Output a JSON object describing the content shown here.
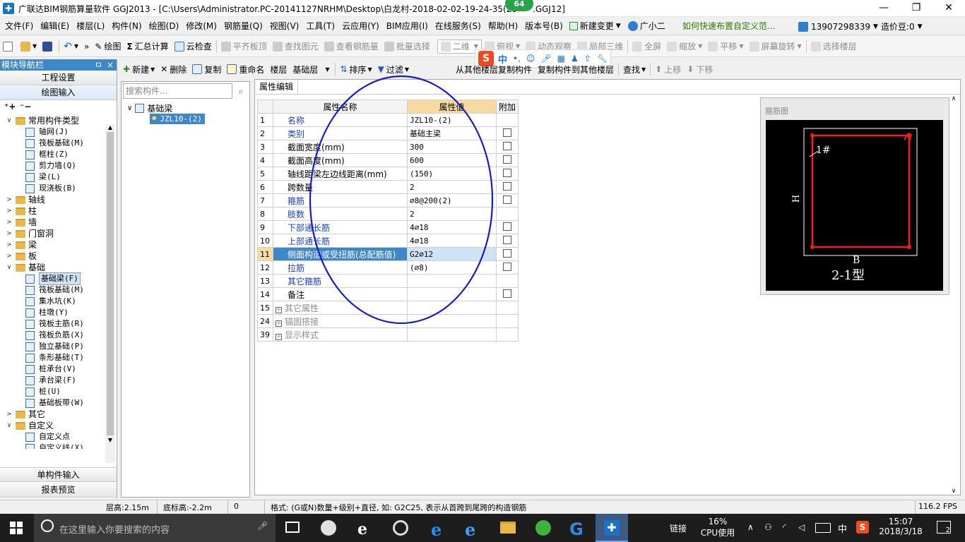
{
  "window": {
    "title": "广联达BIM钢筋算量软件 GGJ2013 - [C:\\Users\\Administrator.PC-20141127NRHM\\Desktop\\白龙村-2018-02-02-19-24-35(20",
    "title_end": ".GGJ12]",
    "badge": "64",
    "minimize": "—",
    "restore": "❐",
    "close": "✕"
  },
  "menu": {
    "items": [
      "文件(F)",
      "编辑(E)",
      "楼层(L)",
      "构件(N)",
      "绘图(D)",
      "修改(M)",
      "钢筋量(Q)",
      "视图(V)",
      "工具(T)",
      "云应用(Y)",
      "BIM应用(I)",
      "在线服务(S)",
      "帮助(H)",
      "版本号(B)"
    ],
    "new_change": "新建变更",
    "assistant": "广小二",
    "tip": "如何快速布置自定义范...",
    "phone": "13907298339",
    "cost_beans": "造价豆:0"
  },
  "toolbar": {
    "draw": "绘图",
    "summary": "汇总计算",
    "cloud_check": "云检查",
    "flat_slab": "平齐板顶",
    "find_element": "查找图元",
    "view_rebar": "查看钢筋量",
    "batch_select": "批量选择",
    "view_2d": "二维",
    "top_view": "俯视",
    "dynamic_view": "动态观察",
    "local_3d": "局部三维",
    "fullscreen": "全屏",
    "zoom": "缩放",
    "pan": "平移",
    "rotate": "屏幕旋转",
    "select_floor": "选择楼层"
  },
  "ime": {
    "logo": "S",
    "lang": "中"
  },
  "leftnav": {
    "title": "模块导航栏",
    "pin": "ㅁ",
    "close": "×",
    "project_settings": "工程设置",
    "drawing_input": "绘图输入",
    "single_input": "单构件输入",
    "report_preview": "报表预览",
    "tree": [
      {
        "label": "常用构件类型",
        "level": 0,
        "exp": "∨",
        "type": "folder"
      },
      {
        "label": "轴网(J)",
        "level": 1,
        "type": "item"
      },
      {
        "label": "筏板基础(M)",
        "level": 1,
        "type": "item"
      },
      {
        "label": "框柱(Z)",
        "level": 1,
        "type": "item"
      },
      {
        "label": "剪力墙(Q)",
        "level": 1,
        "type": "item"
      },
      {
        "label": "梁(L)",
        "level": 1,
        "type": "item"
      },
      {
        "label": "现浇板(B)",
        "level": 1,
        "type": "item"
      },
      {
        "label": "轴线",
        "level": 0,
        "exp": ">",
        "type": "folder"
      },
      {
        "label": "柱",
        "level": 0,
        "exp": ">",
        "type": "folder"
      },
      {
        "label": "墙",
        "level": 0,
        "exp": ">",
        "type": "folder"
      },
      {
        "label": "门窗洞",
        "level": 0,
        "exp": ">",
        "type": "folder"
      },
      {
        "label": "梁",
        "level": 0,
        "exp": ">",
        "type": "folder"
      },
      {
        "label": "板",
        "level": 0,
        "exp": ">",
        "type": "folder"
      },
      {
        "label": "基础",
        "level": 0,
        "exp": "∨",
        "type": "folder"
      },
      {
        "label": "基础梁(F)",
        "level": 1,
        "type": "item",
        "selected": true
      },
      {
        "label": "筏板基础(M)",
        "level": 1,
        "type": "item"
      },
      {
        "label": "集水坑(K)",
        "level": 1,
        "type": "item"
      },
      {
        "label": "柱墩(Y)",
        "level": 1,
        "type": "item"
      },
      {
        "label": "筏板主筋(R)",
        "level": 1,
        "type": "item"
      },
      {
        "label": "筏板负筋(X)",
        "level": 1,
        "type": "item"
      },
      {
        "label": "独立基础(P)",
        "level": 1,
        "type": "item"
      },
      {
        "label": "条形基础(T)",
        "level": 1,
        "type": "item"
      },
      {
        "label": "桩承台(V)",
        "level": 1,
        "type": "item"
      },
      {
        "label": "承台梁(F)",
        "level": 1,
        "type": "item"
      },
      {
        "label": "桩(U)",
        "level": 1,
        "type": "item"
      },
      {
        "label": "基础板带(W)",
        "level": 1,
        "type": "item"
      },
      {
        "label": "其它",
        "level": 0,
        "exp": ">",
        "type": "folder"
      },
      {
        "label": "自定义",
        "level": 0,
        "exp": "∨",
        "type": "folder"
      },
      {
        "label": "自定义点",
        "level": 1,
        "type": "item"
      },
      {
        "label": "自定义线(X)",
        "level": 1,
        "type": "item"
      }
    ]
  },
  "tb2": {
    "new": "新建",
    "delete": "删除",
    "copy": "复制",
    "rename": "重命名",
    "floor_label": "楼层",
    "floor_value": "基础层",
    "sort": "排序",
    "filter": "过滤",
    "copy_from_other": "从其他楼层复制构件",
    "copy_to_other": "复制构件到其他楼层",
    "find": "查找",
    "move_up": "上移",
    "move_down": "下移"
  },
  "search": {
    "placeholder": "搜索构件...",
    "root": "基础梁",
    "child": "JZL10-(2)"
  },
  "props": {
    "tab": "属性编辑",
    "headers": {
      "name": "属性名称",
      "value": "属性值",
      "extra": "附加"
    },
    "rows": [
      {
        "n": "1",
        "name": "名称",
        "value": "JZL10-(2)",
        "blue": true,
        "cb": false
      },
      {
        "n": "2",
        "name": "类别",
        "value": "基础主梁",
        "blue": true,
        "cb": true
      },
      {
        "n": "3",
        "name": "截面宽度(mm)",
        "value": "300",
        "blue": false,
        "cb": true
      },
      {
        "n": "4",
        "name": "截面高度(mm)",
        "value": "600",
        "blue": false,
        "cb": true
      },
      {
        "n": "5",
        "name": "轴线距梁左边线距离(mm)",
        "value": "(150)",
        "blue": false,
        "cb": true
      },
      {
        "n": "6",
        "name": "跨数量",
        "value": "2",
        "blue": false,
        "cb": true
      },
      {
        "n": "7",
        "name": "箍筋",
        "value": "⌀8@200(2)",
        "blue": true,
        "cb": true
      },
      {
        "n": "8",
        "name": "肢数",
        "value": "2",
        "blue": true,
        "cb": false
      },
      {
        "n": "9",
        "name": "下部通长筋",
        "value": "4⌀18",
        "blue": true,
        "cb": true
      },
      {
        "n": "10",
        "name": "上部通长筋",
        "value": "4⌀18",
        "blue": true,
        "cb": true
      },
      {
        "n": "11",
        "name": "侧面构造或受扭筋(总配筋值)",
        "value": "G2⌀12",
        "blue": false,
        "cb": true,
        "selected": true
      },
      {
        "n": "12",
        "name": "拉筋",
        "value": "(⌀8)",
        "blue": true,
        "cb": true
      },
      {
        "n": "13",
        "name": "其它箍筋",
        "value": "",
        "blue": true,
        "cb": false
      },
      {
        "n": "14",
        "name": "备注",
        "value": "",
        "blue": false,
        "cb": true
      },
      {
        "n": "15",
        "name": "其它属性",
        "value": "",
        "blue": false,
        "cb": false,
        "group": true
      },
      {
        "n": "24",
        "name": "锚固搭接",
        "value": "",
        "blue": false,
        "cb": false,
        "group": true
      },
      {
        "n": "39",
        "name": "显示样式",
        "value": "",
        "blue": false,
        "cb": false,
        "group": true
      }
    ]
  },
  "preview": {
    "title": "箍筋图",
    "label_1": "1#",
    "label_h": "H",
    "label_b": "B",
    "type_label": "2-1型"
  },
  "status": {
    "floor_height": "层高:2.15m",
    "bottom_elev": "底标高:-2.2m",
    "zero": "0",
    "hint": "格式: (G或N)数量+级别+直径, 如: G2C25, 表示从首跨到尾跨的构造钢筋",
    "fps": "116.2 FPS"
  },
  "taskbar": {
    "search_placeholder": "在这里输入你要搜索的内容",
    "link": "链接",
    "cpu_pct": "16%",
    "cpu_label": "CPU使用",
    "ime": "中",
    "time": "15:07",
    "date": "2018/3/18",
    "notif": "2"
  },
  "colors": {
    "accent": "#3e87c9",
    "select": "#cfe3f7",
    "highlight_col": "#f8d9a0",
    "annotation": "#1a1acb",
    "rebar": "#ff1a1a"
  }
}
